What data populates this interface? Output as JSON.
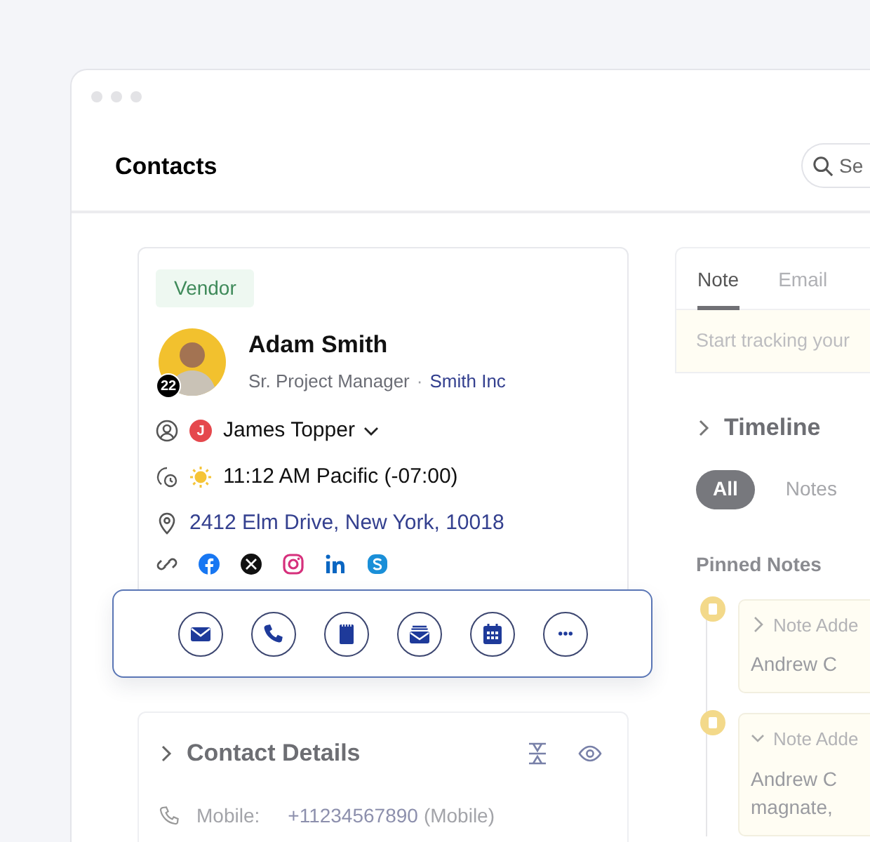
{
  "window": {
    "title": "Contacts",
    "search": {
      "placeholder": "Se"
    }
  },
  "contact_card": {
    "tag": "Vendor",
    "name": "Adam Smith",
    "job_title": "Sr. Project Manager",
    "separator": "·",
    "company": "Smith Inc",
    "avatar_badge": "22",
    "owner": {
      "initial": "J",
      "name": "James Topper",
      "color": "#e5484d"
    },
    "local_time": "11:12 AM Pacific (-07:00)",
    "address": "2412 Elm Drive, New York, 10018",
    "social": [
      {
        "kind": "facebook"
      },
      {
        "kind": "x"
      },
      {
        "kind": "instagram"
      },
      {
        "kind": "linkedin"
      },
      {
        "kind": "skype"
      }
    ]
  },
  "actions": [
    {
      "kind": "email"
    },
    {
      "kind": "call"
    },
    {
      "kind": "note"
    },
    {
      "kind": "mail"
    },
    {
      "kind": "meeting"
    },
    {
      "kind": "more"
    }
  ],
  "contact_details": {
    "title": "Contact Details",
    "expanded": false,
    "fields": [
      {
        "label": "Mobile:",
        "value": "+11234567890",
        "note": "(Mobile)"
      }
    ]
  },
  "composer": {
    "tabs": [
      {
        "label": "Note",
        "selected": true
      },
      {
        "label": "Email",
        "selected": false
      }
    ],
    "placeholder": "Start tracking your"
  },
  "timeline": {
    "title": "Timeline",
    "expanded": false,
    "filters": [
      {
        "label": "All",
        "selected": true
      },
      {
        "label": "Notes",
        "selected": false
      }
    ],
    "pinned_title": "Pinned Notes",
    "notes": [
      {
        "title": "Note Adde",
        "expanded": false,
        "lines": [
          "Andrew C"
        ]
      },
      {
        "title": "Note Adde",
        "expanded": true,
        "lines": [
          "Andrew C",
          "magnate,"
        ]
      }
    ]
  }
}
